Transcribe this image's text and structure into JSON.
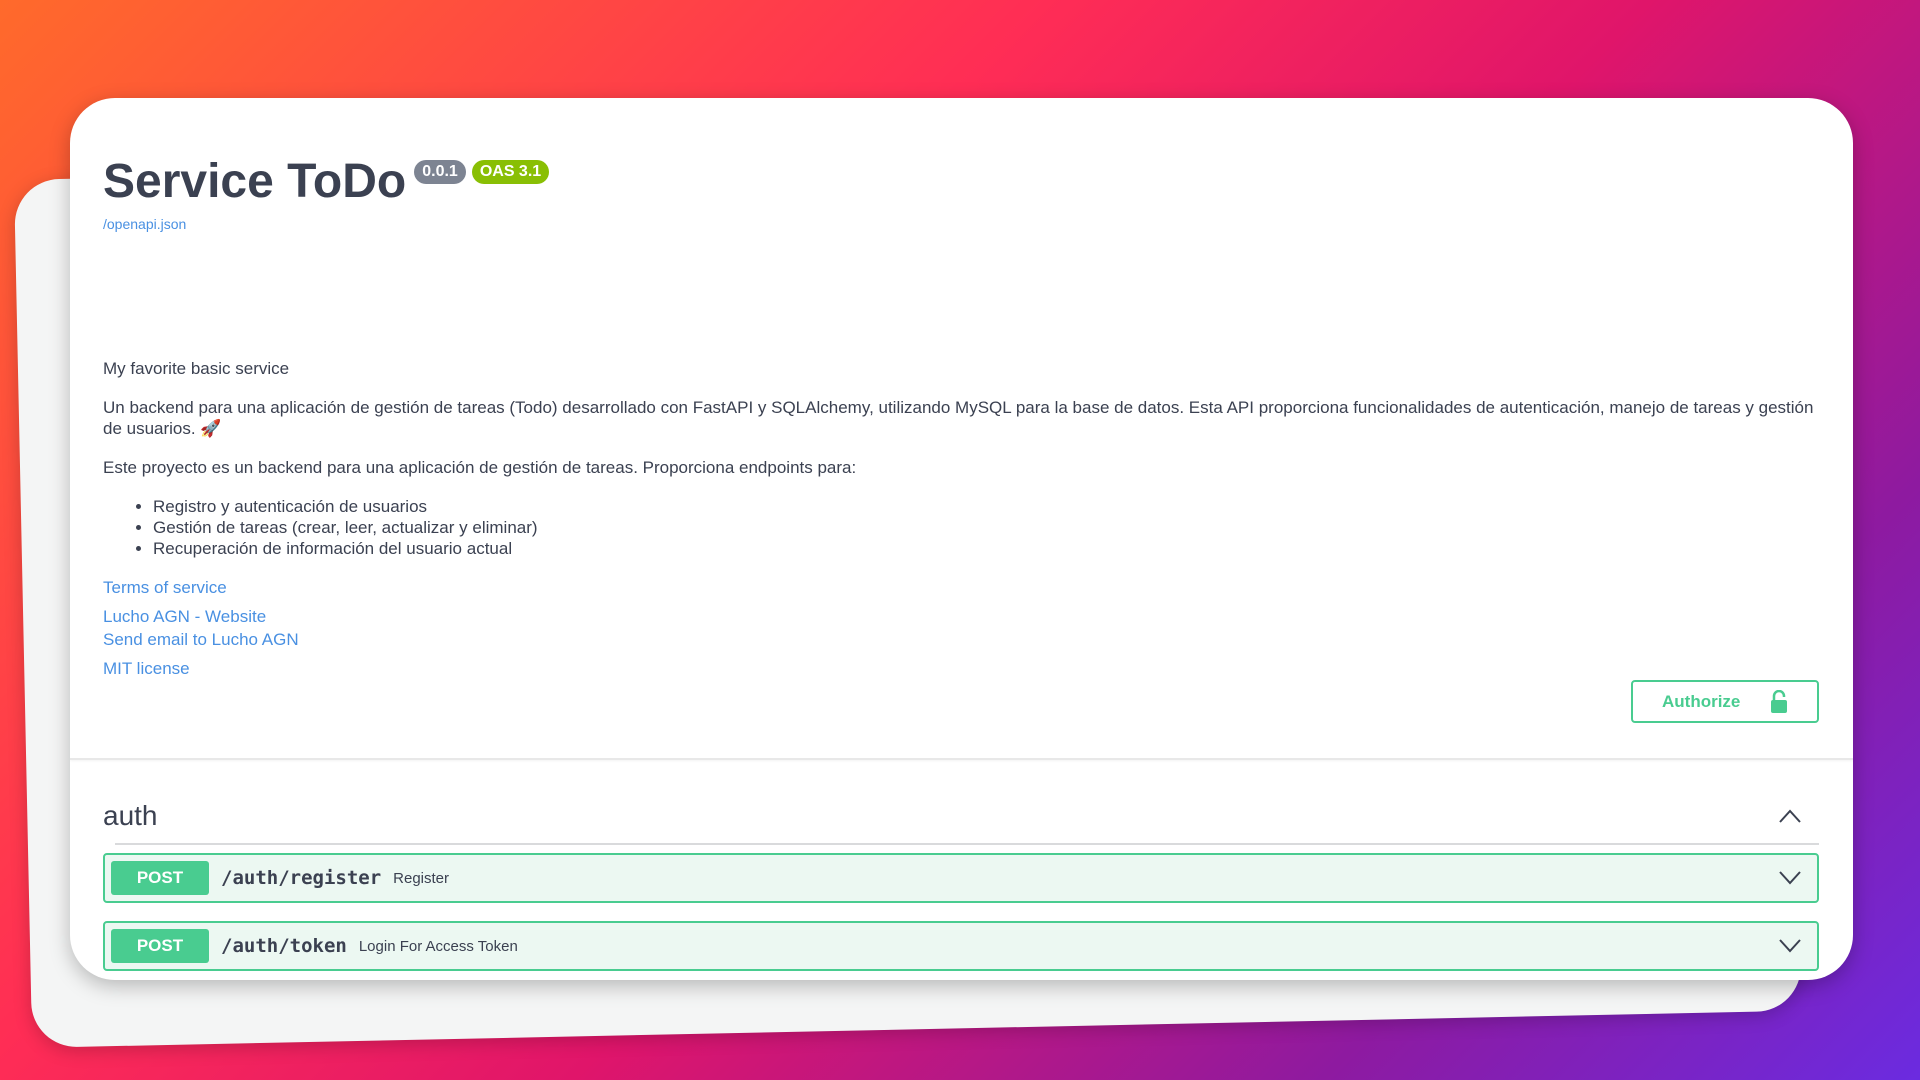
{
  "info": {
    "title": "Service ToDo",
    "version": "0.0.1",
    "oas": "OAS 3.1",
    "spec_url": "/openapi.json",
    "summary": "My favorite basic service",
    "description": "Un backend para una aplicación de gestión de tareas (Todo) desarrollado con FastAPI y SQLAlchemy, utilizando MySQL para la base de datos. Esta API proporciona funcionalidades de autenticación, manejo de tareas y gestión de usuarios. 🚀",
    "intro": "Este proyecto es un backend para una aplicación de gestión de tareas. Proporciona endpoints para:",
    "bullets": [
      "Registro y autenticación de usuarios",
      "Gestión de tareas (crear, leer, actualizar y eliminar)",
      "Recuperación de información del usuario actual"
    ],
    "links": {
      "terms": "Terms of service",
      "website": "Lucho AGN - Website",
      "email": "Send email to Lucho AGN",
      "license": "MIT license"
    }
  },
  "authorize": {
    "label": "Authorize",
    "icon": "unlocked-icon"
  },
  "tag": {
    "name": "auth",
    "expanded": true
  },
  "operations": [
    {
      "method": "POST",
      "path": "/auth/register",
      "summary": "Register"
    },
    {
      "method": "POST",
      "path": "/auth/token",
      "summary": "Login For Access Token"
    }
  ],
  "colors": {
    "post": "#49cc90",
    "link": "#4990e2",
    "version_badge": "#7d8492",
    "oas_badge": "#89bf04"
  }
}
